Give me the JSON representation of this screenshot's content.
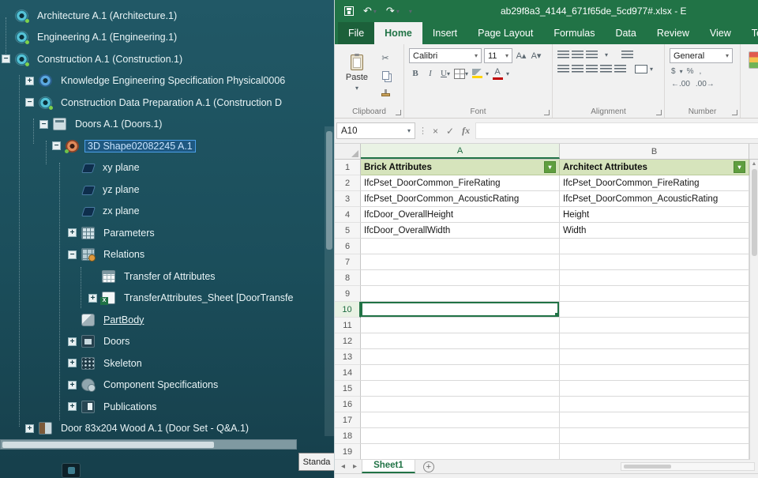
{
  "left_panel": {
    "standard_button": "Standa",
    "tree": {
      "items": [
        {
          "label": "Architecture A.1 (Architecture.1)"
        },
        {
          "label": "Engineering A.1 (Engineering.1)"
        },
        {
          "label": "Construction A.1 (Construction.1)"
        },
        {
          "label": "Knowledge Engineering Specification Physical0006"
        },
        {
          "label": "Construction Data Preparation A.1 (Construction D"
        },
        {
          "label": "Doors A.1 (Doors.1)"
        },
        {
          "label": "3D Shape02082245 A.1"
        },
        {
          "label": "xy plane"
        },
        {
          "label": "yz plane"
        },
        {
          "label": "zx plane"
        },
        {
          "label": "Parameters"
        },
        {
          "label": "Relations"
        },
        {
          "label": "Transfer of Attributes"
        },
        {
          "label": "TransferAttributes_Sheet [DoorTransfe"
        },
        {
          "label": "PartBody"
        },
        {
          "label": "Doors"
        },
        {
          "label": "Skeleton"
        },
        {
          "label": "Component Specifications"
        },
        {
          "label": "Publications"
        },
        {
          "label": "Door 83x204 Wood A.1 (Door Set - Q&A.1)"
        }
      ]
    }
  },
  "excel": {
    "titlebar": {
      "title": "ab29f8a3_4144_671f65de_5cd977#.xlsx - E"
    },
    "tabs": {
      "file": "File",
      "home": "Home",
      "insert": "Insert",
      "page_layout": "Page Layout",
      "formulas": "Formulas",
      "data": "Data",
      "review": "Review",
      "view": "View",
      "team": "Team"
    },
    "ribbon": {
      "paste": "Paste",
      "clipboard": "Clipboard",
      "font_group": "Font",
      "alignment_group": "Alignment",
      "number_group": "Number",
      "font_name": "Calibri",
      "font_size": "11",
      "number_format": "General",
      "bold": "B",
      "italic": "I",
      "underline": "U"
    },
    "formula_bar": {
      "name_box": "A10",
      "fx": "fx",
      "formula": ""
    },
    "sheet": {
      "col_a": "A",
      "col_b": "B",
      "rows": [
        {
          "n": "1",
          "a": "Brick Attributes",
          "b": "Architect Attributes"
        },
        {
          "n": "2",
          "a": "IfcPset_DoorCommon_FireRating",
          "b": "IfcPset_DoorCommon_FireRating"
        },
        {
          "n": "3",
          "a": "IfcPset_DoorCommon_AcousticRating",
          "b": "IfcPset_DoorCommon_AcousticRating"
        },
        {
          "n": "4",
          "a": "IfcDoor_OverallHeight",
          "b": "Height"
        },
        {
          "n": "5",
          "a": "IfcDoor_OverallWidth",
          "b": "Width"
        },
        {
          "n": "6",
          "a": "",
          "b": ""
        },
        {
          "n": "7",
          "a": "",
          "b": ""
        },
        {
          "n": "8",
          "a": "",
          "b": ""
        },
        {
          "n": "9",
          "a": "",
          "b": ""
        },
        {
          "n": "10",
          "a": "",
          "b": ""
        },
        {
          "n": "11",
          "a": "",
          "b": ""
        },
        {
          "n": "12",
          "a": "",
          "b": ""
        },
        {
          "n": "13",
          "a": "",
          "b": ""
        },
        {
          "n": "14",
          "a": "",
          "b": ""
        },
        {
          "n": "15",
          "a": "",
          "b": ""
        },
        {
          "n": "16",
          "a": "",
          "b": ""
        },
        {
          "n": "17",
          "a": "",
          "b": ""
        },
        {
          "n": "18",
          "a": "",
          "b": ""
        },
        {
          "n": "19",
          "a": "",
          "b": ""
        }
      ]
    },
    "sheet_tabs": {
      "active": "Sheet1"
    }
  },
  "icons": {
    "minus": "−",
    "plus": "+",
    "caret": "▾",
    "undo": "↶",
    "redo": "↷",
    "cut": "✂",
    "cancel": "×",
    "check": "✓",
    "dots": "⋮",
    "nav_left": "◂",
    "nav_right": "▸",
    "up": "▲",
    "down": "▼",
    "new_sheet": "+",
    "grow_font": "A▴",
    "shrink_font": "A▾",
    "accounting": "$",
    "percent": "%",
    "comma": ",",
    "increase_decimal": "←.00",
    "decrease_decimal": ".00→",
    "font_color": "A"
  },
  "colors": {
    "excel_green": "#217346",
    "header_fill": "#d6e4bc",
    "filter_green": "#5f9e3e",
    "left_pane_teal": "#1b4e5b",
    "selection_blue": "#4b9fe8"
  }
}
